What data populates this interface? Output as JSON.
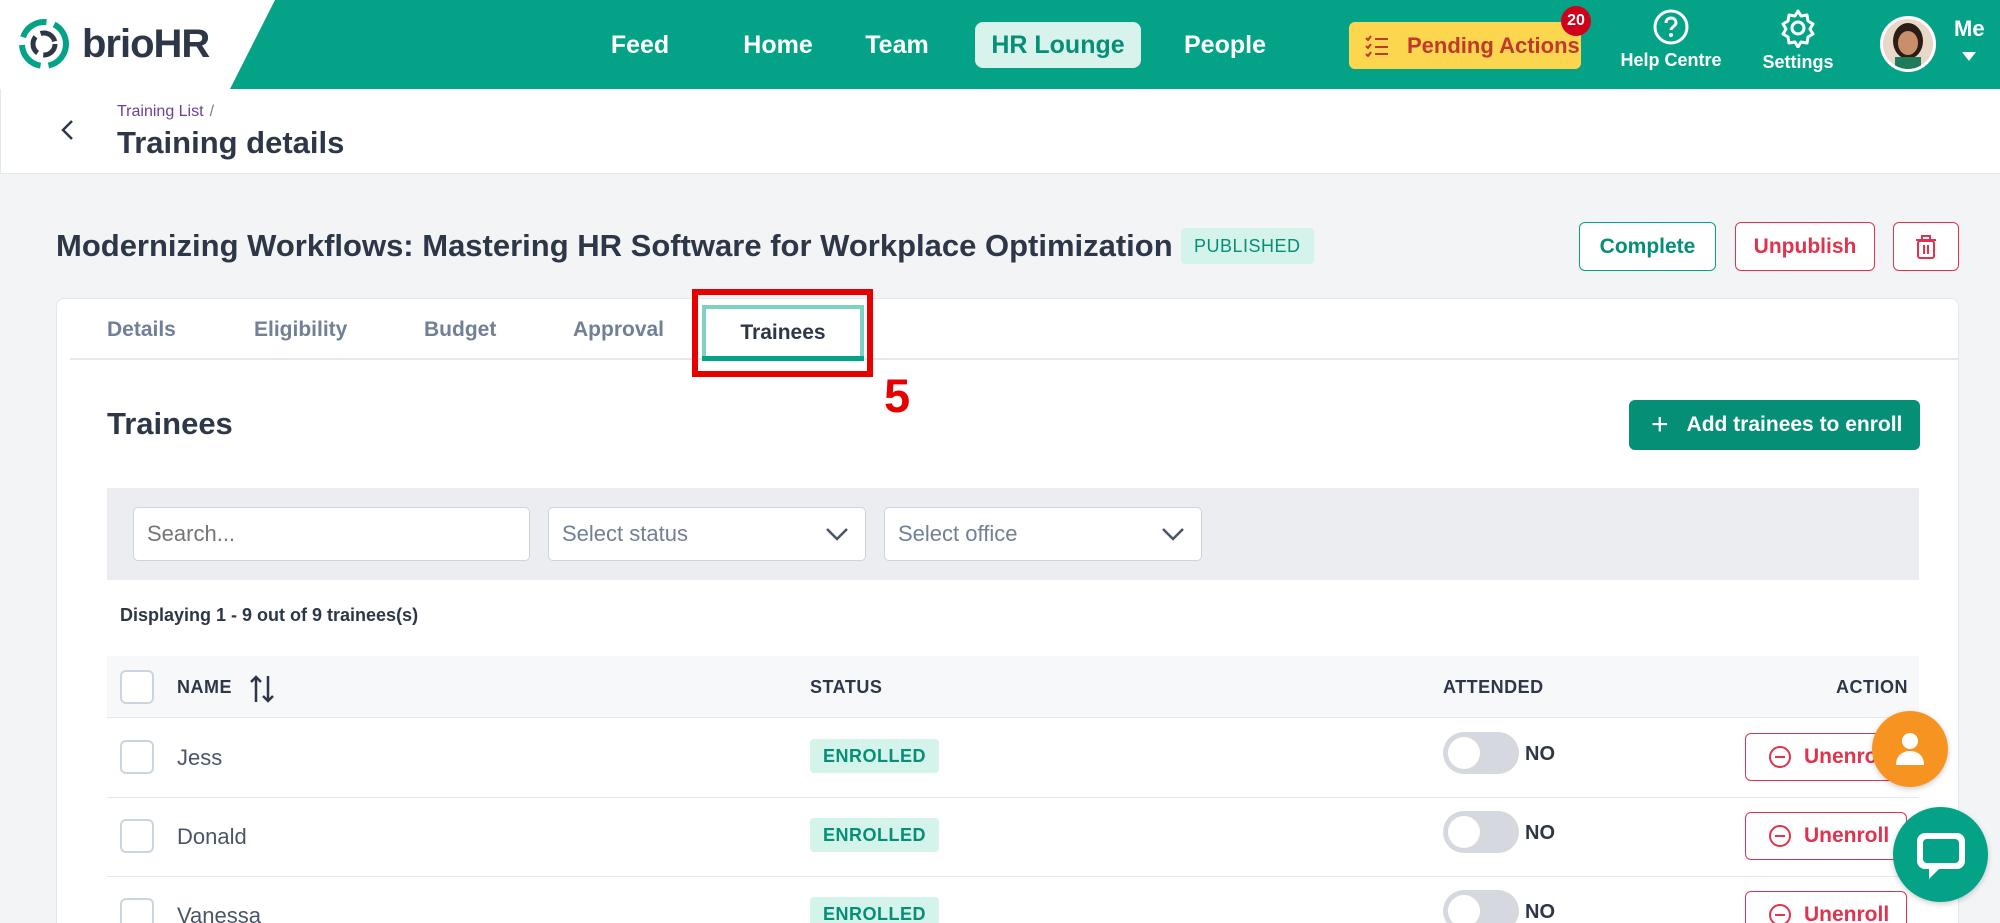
{
  "app": {
    "brand_prefix": "brio",
    "brand_suffix": "HR"
  },
  "nav": {
    "items": [
      {
        "label": "Feed"
      },
      {
        "label": "Home"
      },
      {
        "label": "Team"
      },
      {
        "label": "HR Lounge",
        "active": true
      },
      {
        "label": "People"
      }
    ],
    "pending_label": "Pending Actions",
    "pending_count": "20",
    "help_label": "Help Centre",
    "settings_label": "Settings",
    "me_label": "Me"
  },
  "breadcrumb": {
    "parent": "Training List",
    "separator": "/",
    "title": "Training details"
  },
  "training": {
    "title": "Modernizing Workflows: Mastering HR Software for Workplace Optimization",
    "status": "PUBLISHED",
    "complete_label": "Complete",
    "unpublish_label": "Unpublish"
  },
  "tabs": [
    {
      "label": "Details"
    },
    {
      "label": "Eligibility"
    },
    {
      "label": "Budget"
    },
    {
      "label": "Approval"
    },
    {
      "label": "Trainees",
      "active": true
    }
  ],
  "annotation": {
    "step": "5"
  },
  "trainees": {
    "heading": "Trainees",
    "add_label": "Add trainees to enroll",
    "search_placeholder": "Search...",
    "status_placeholder": "Select status",
    "office_placeholder": "Select office",
    "displaying": "Displaying 1 - 9 out of 9 trainees(s)",
    "columns": {
      "name": "NAME",
      "status": "STATUS",
      "attended": "ATTENDED",
      "action": "ACTION"
    },
    "rows": [
      {
        "name": "Jess",
        "status": "ENROLLED",
        "attended": "NO",
        "action": "Unenroll"
      },
      {
        "name": "Donald",
        "status": "ENROLLED",
        "attended": "NO",
        "action": "Unenroll"
      },
      {
        "name": "Vanessa",
        "status": "ENROLLED",
        "attended": "NO",
        "action": "Unenroll"
      }
    ]
  },
  "colors": {
    "brand_green": "#04a286",
    "pending_yellow": "#fcd64f",
    "danger": "#e0334d",
    "annotation_red": "#e60000"
  }
}
